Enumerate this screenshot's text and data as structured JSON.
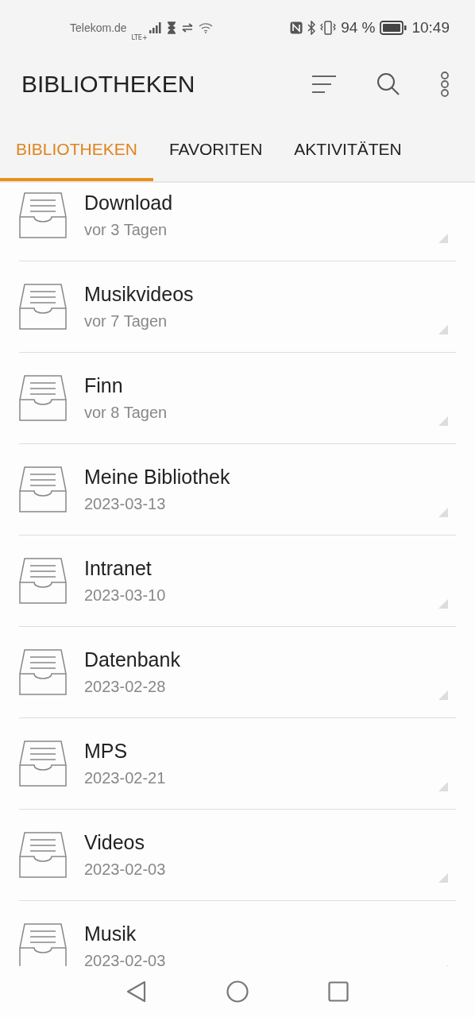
{
  "status_bar": {
    "carrier": "Telekom.de",
    "network": "LTE+",
    "battery_text": "94 %",
    "time": "10:49"
  },
  "toolbar": {
    "title": "BIBLIOTHEKEN"
  },
  "tabs": [
    {
      "label": "BIBLIOTHEKEN",
      "selected": true
    },
    {
      "label": "FAVORITEN",
      "selected": false
    },
    {
      "label": "AKTIVITÄTEN",
      "selected": false
    }
  ],
  "libraries": [
    {
      "name": "Download",
      "modified": "vor 3 Tagen"
    },
    {
      "name": "Musikvideos",
      "modified": "vor 7 Tagen"
    },
    {
      "name": "Finn",
      "modified": "vor 8 Tagen"
    },
    {
      "name": "Meine Bibliothek",
      "modified": "2023-03-13"
    },
    {
      "name": "Intranet",
      "modified": "2023-03-10"
    },
    {
      "name": "Datenbank",
      "modified": "2023-02-28"
    },
    {
      "name": "MPS",
      "modified": "2023-02-21"
    },
    {
      "name": "Videos",
      "modified": "2023-02-03"
    },
    {
      "name": "Musik",
      "modified": "2023-02-03"
    }
  ]
}
